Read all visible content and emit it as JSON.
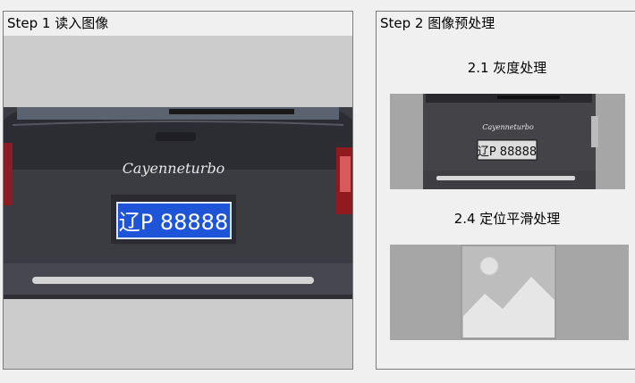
{
  "step1": {
    "title": "Step 1 读入图像",
    "plate": "辽P 88888",
    "badge": "Cayenneturbo"
  },
  "step2": {
    "title": "Step 2 图像预处理",
    "section_gray": {
      "title": "2.1 灰度处理",
      "plate": "辽P 88888",
      "badge": "Cayenneturbo"
    },
    "section_locate": {
      "title": "2.4 定位平滑处理",
      "placeholder_icon": "image-placeholder-icon"
    }
  },
  "colors": {
    "plate_blue": "#1e55d8",
    "panel_bg": "#f0f0f0",
    "image_bg": "#cccccc",
    "gray_bg": "#a6a6a6"
  }
}
